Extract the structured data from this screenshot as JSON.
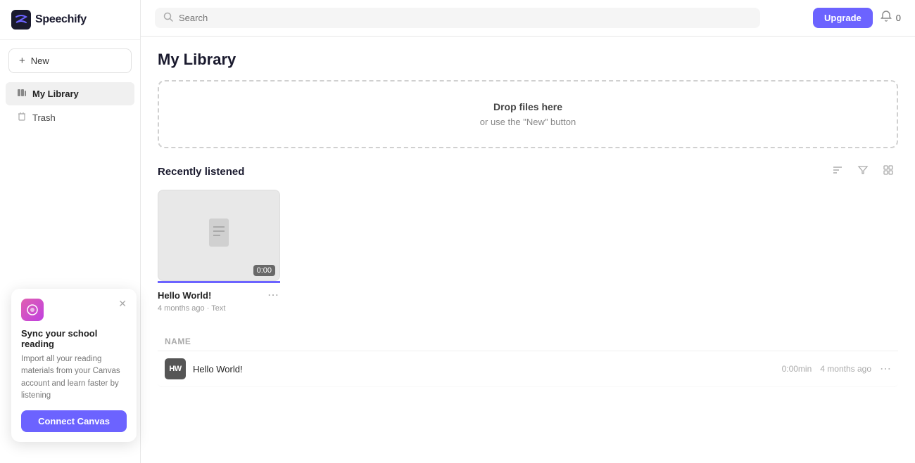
{
  "logo": {
    "name": "Speechify",
    "icon_text": "🎧"
  },
  "sidebar": {
    "new_button": "+ New",
    "items": [
      {
        "id": "my-library",
        "label": "My Library",
        "icon": "📚",
        "active": true
      },
      {
        "id": "trash",
        "label": "Trash",
        "icon": "🗑️",
        "active": false
      }
    ]
  },
  "header": {
    "search_placeholder": "Search",
    "upgrade_label": "Upgrade",
    "notification_count": "0"
  },
  "main": {
    "title": "My Library",
    "drop_zone": {
      "primary": "Drop files here",
      "secondary": "or use the \"New\" button"
    },
    "recently_listened": {
      "section_title": "Recently listened",
      "cards": [
        {
          "title": "Hello World!",
          "duration": "0:00",
          "months_ago": "4 months ago",
          "type": "Text",
          "progress_pct": 100
        }
      ]
    },
    "table": {
      "columns": [
        "Name"
      ],
      "rows": [
        {
          "icon_text": "HW",
          "name": "Hello World!",
          "duration": "0:00min",
          "months_ago": "4 months ago"
        }
      ]
    }
  },
  "canvas_popup": {
    "title": "Sync your school reading",
    "description": "Import all your reading materials from your Canvas account and learn faster by listening",
    "connect_button": "Connect Canvas",
    "close_icon": "✕"
  }
}
